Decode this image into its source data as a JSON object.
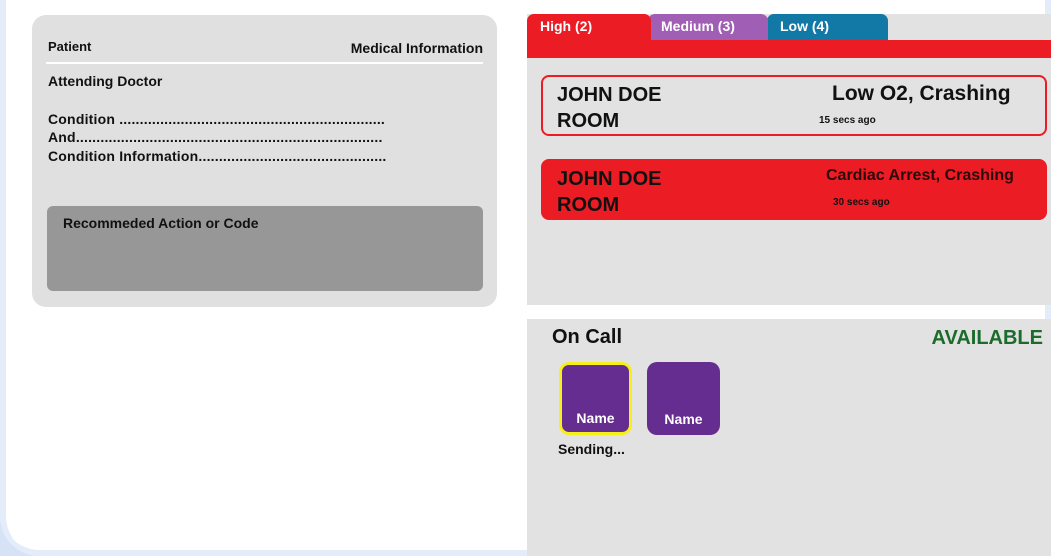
{
  "patient_card": {
    "patient_label": "Patient",
    "medical_info_label": "Medical Information",
    "attending_doctor_label": "Attending Doctor",
    "condition_lines": [
      "Condition .................................................................",
      "And...........................................................................",
      "Condition Information.............................................."
    ],
    "recommended_action_label": "Recommeded Action or Code"
  },
  "alerts": {
    "tabs": [
      {
        "label": "High (2)",
        "color": "#ec1c24"
      },
      {
        "label": "Medium (3)",
        "color": "#a05fb4"
      },
      {
        "label": "Low (4)",
        "color": "#1278a6"
      }
    ],
    "items": [
      {
        "name": "JOHN DOE",
        "room": "ROOM",
        "condition": "Low O2, Crashing",
        "time": "15 secs ago"
      },
      {
        "name": "JOHN DOE",
        "room": "ROOM",
        "condition": "Cardiac Arrest, Crashing",
        "time": "30 secs ago"
      }
    ]
  },
  "on_call": {
    "title": "On Call",
    "status": "AVAILABLE",
    "status_color": "#1a6b2c",
    "staff": [
      {
        "name": "Name",
        "selected": true
      },
      {
        "name": "Name",
        "selected": false
      }
    ],
    "sending_text": "Sending..."
  }
}
